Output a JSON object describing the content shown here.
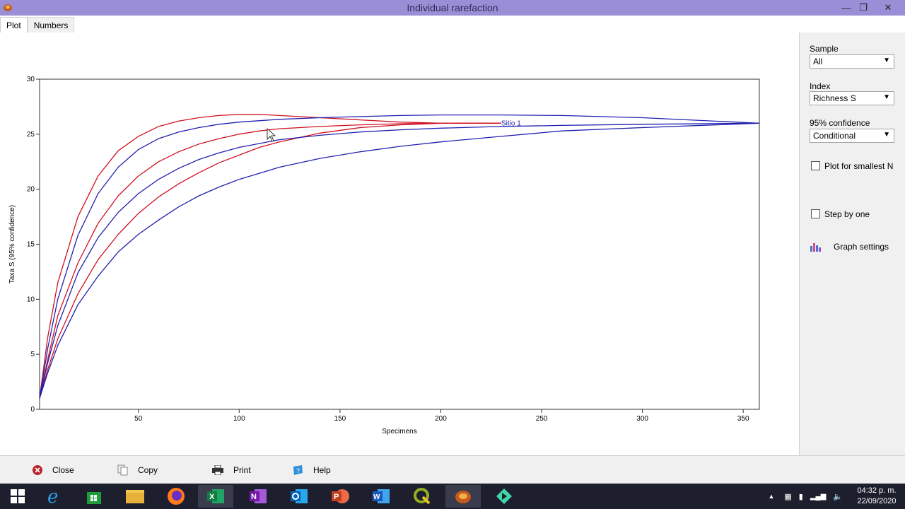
{
  "window": {
    "title": "Individual rarefaction",
    "minimize": "—",
    "restore": "❐",
    "close": "✕"
  },
  "tabs": [
    {
      "label": "Plot"
    },
    {
      "label": "Numbers"
    }
  ],
  "side": {
    "sample_label": "Sample",
    "sample_value": "All",
    "index_label": "Index",
    "index_value": "Richness S",
    "conf_label": "95% confidence",
    "conf_value": "Conditional",
    "smallest_label": "Plot for smallest N",
    "step_label": "Step by one",
    "graph_settings_label": "Graph settings"
  },
  "bottom": {
    "close": "Close",
    "copy": "Copy",
    "print": "Print",
    "help": "Help"
  },
  "taskbar": {
    "time": "04:32 p. m.",
    "date": "22/09/2020"
  },
  "chart_data": {
    "type": "line",
    "xlabel": "Specimens",
    "ylabel": "Taxa S (95% confidence)",
    "xlim": [
      1,
      358
    ],
    "ylim": [
      0,
      30
    ],
    "xticks": [
      50,
      100,
      150,
      200,
      250,
      300,
      350
    ],
    "yticks": [
      0,
      5,
      10,
      15,
      20,
      25,
      30
    ],
    "annotation": "Sitio 1",
    "grid": false,
    "series": [
      {
        "color": "#d01020",
        "x": [
          1,
          5,
          10,
          20,
          30,
          40,
          50,
          60,
          70,
          80,
          90,
          100,
          110,
          120,
          140,
          160,
          180,
          200,
          220,
          230
        ],
        "y": [
          1,
          6.5,
          11.5,
          17.5,
          21.2,
          23.5,
          24.8,
          25.7,
          26.2,
          26.5,
          26.7,
          26.8,
          26.8,
          26.7,
          26.5,
          26.3,
          26.1,
          26,
          26,
          26
        ]
      },
      {
        "color": "#d01020",
        "x": [
          1,
          5,
          10,
          20,
          30,
          40,
          50,
          60,
          70,
          80,
          90,
          100,
          110,
          120,
          140,
          160,
          180,
          200,
          220,
          230
        ],
        "y": [
          1,
          4.5,
          8.5,
          13.3,
          16.9,
          19.4,
          21.2,
          22.5,
          23.4,
          24.1,
          24.6,
          25,
          25.3,
          25.5,
          25.7,
          25.85,
          25.95,
          26,
          26,
          26
        ]
      },
      {
        "color": "#d01020",
        "x": [
          1,
          5,
          10,
          20,
          30,
          40,
          50,
          60,
          70,
          80,
          90,
          100,
          110,
          120,
          140,
          160,
          180,
          200,
          220,
          230
        ],
        "y": [
          1,
          3.6,
          6.4,
          10.5,
          13.6,
          15.9,
          17.8,
          19.3,
          20.5,
          21.5,
          22.4,
          23.1,
          23.8,
          24.3,
          25.1,
          25.6,
          25.85,
          26,
          26,
          26
        ]
      },
      {
        "color": "#2020b0",
        "x": [
          1,
          5,
          10,
          20,
          30,
          40,
          50,
          60,
          70,
          80,
          90,
          100,
          120,
          140,
          160,
          180,
          200,
          230,
          260,
          300,
          358
        ],
        "y": [
          1,
          5.5,
          10,
          15.8,
          19.6,
          22,
          23.6,
          24.6,
          25.2,
          25.6,
          25.9,
          26.1,
          26.35,
          26.5,
          26.6,
          26.7,
          26.75,
          26.75,
          26.7,
          26.5,
          26
        ]
      },
      {
        "color": "#2020b0",
        "x": [
          1,
          5,
          10,
          20,
          30,
          40,
          50,
          60,
          70,
          80,
          90,
          100,
          120,
          140,
          160,
          180,
          200,
          230,
          260,
          300,
          358
        ],
        "y": [
          1,
          4.2,
          7.6,
          12.4,
          15.6,
          17.9,
          19.6,
          20.9,
          21.9,
          22.7,
          23.3,
          23.8,
          24.5,
          24.9,
          25.2,
          25.4,
          25.55,
          25.7,
          25.8,
          25.9,
          26
        ]
      },
      {
        "color": "#2020b0",
        "x": [
          1,
          5,
          10,
          20,
          30,
          40,
          50,
          60,
          70,
          80,
          90,
          100,
          120,
          140,
          160,
          180,
          200,
          230,
          260,
          300,
          358
        ],
        "y": [
          1,
          3.3,
          5.8,
          9.5,
          12.1,
          14.3,
          15.9,
          17.2,
          18.4,
          19.4,
          20.2,
          20.9,
          22,
          22.8,
          23.4,
          23.9,
          24.3,
          24.8,
          25.3,
          25.6,
          26
        ]
      }
    ]
  }
}
